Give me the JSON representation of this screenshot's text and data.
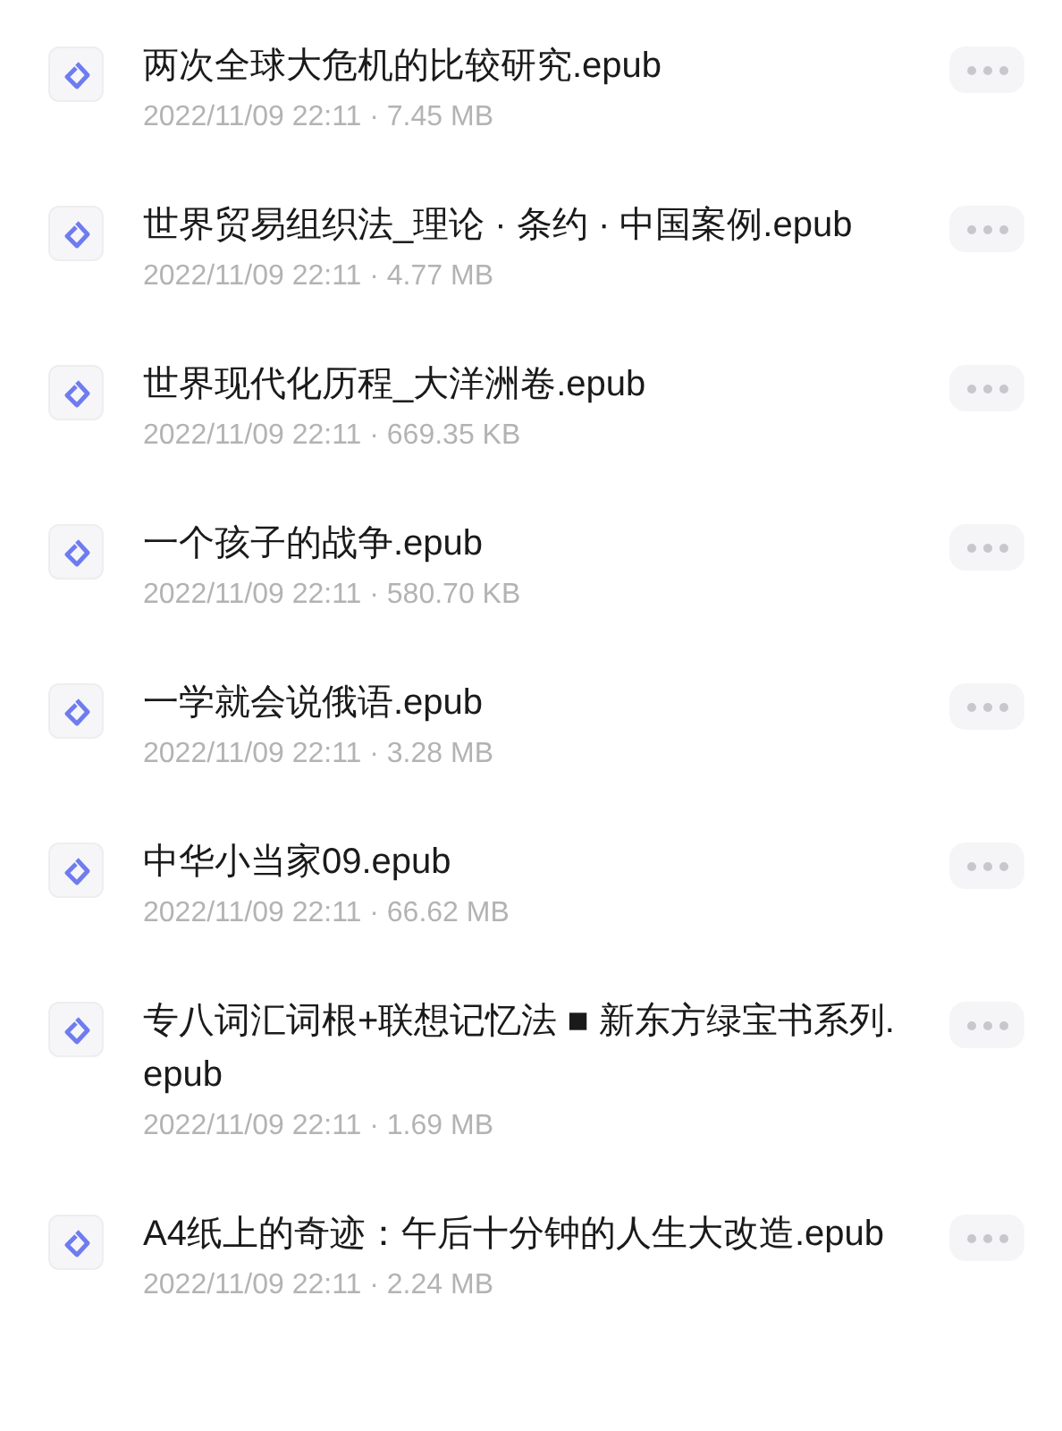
{
  "files": [
    {
      "name": "两次全球大危机的比较研究.epub",
      "meta": "2022/11/09 22:11 · 7.45 MB"
    },
    {
      "name": "世界贸易组织法_理论 · 条约 · 中国案例.epub",
      "meta": "2022/11/09 22:11 · 4.77 MB"
    },
    {
      "name": "世界现代化历程_大洋洲卷.epub",
      "meta": "2022/11/09 22:11 · 669.35 KB"
    },
    {
      "name": "一个孩子的战争.epub",
      "meta": "2022/11/09 22:11 · 580.70 KB"
    },
    {
      "name": "一学就会说俄语.epub",
      "meta": "2022/11/09 22:11 · 3.28 MB"
    },
    {
      "name": "中华小当家09.epub",
      "meta": "2022/11/09 22:11 · 66.62 MB"
    },
    {
      "name": "专八词汇词根+联想记忆法 ■ 新东方绿宝书系列.epub",
      "meta": "2022/11/09 22:11 · 1.69 MB"
    },
    {
      "name": "A4纸上的奇迹：午后十分钟的人生大改造.epub",
      "meta": "2022/11/09 22:11 · 2.24 MB"
    }
  ]
}
